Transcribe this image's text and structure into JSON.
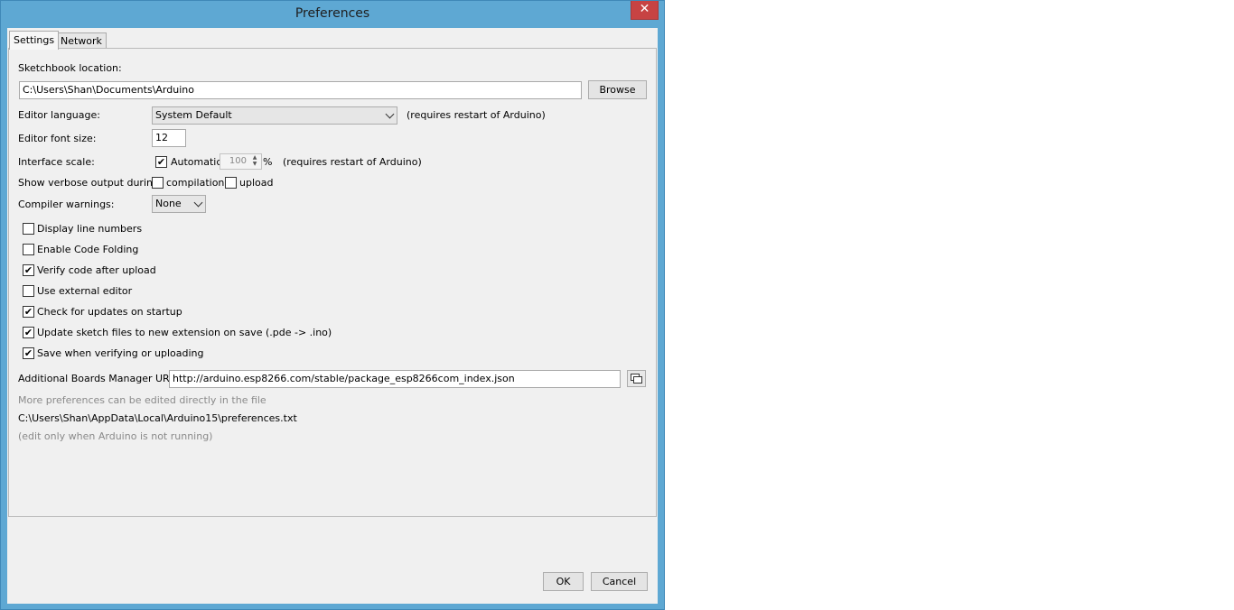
{
  "window": {
    "title": "Preferences",
    "close_glyph": "✕"
  },
  "tabs": [
    {
      "label": "Settings"
    },
    {
      "label": "Network"
    }
  ],
  "settings": {
    "sketchbook_label": "Sketchbook location:",
    "sketchbook_value": "C:\\Users\\Shan\\Documents\\Arduino",
    "browse_label": "Browse",
    "editor_language_label": "Editor language:",
    "editor_language_value": "System Default",
    "restart_note": "(requires restart of Arduino)",
    "font_size_label": "Editor font size:",
    "font_size_value": "12",
    "scale_label": "Interface scale:",
    "scale_automatic_label": "Automatic",
    "scale_automatic_checked": true,
    "scale_value": "100",
    "percent_sign": "%",
    "scale_restart_note": "(requires restart of Arduino)",
    "verbose_label": "Show verbose output during:",
    "verbose_compilation_label": "compilation",
    "verbose_compilation_checked": false,
    "verbose_upload_label": "upload",
    "verbose_upload_checked": false,
    "warnings_label": "Compiler warnings:",
    "warnings_value": "None",
    "checkboxes": [
      {
        "label": "Display line numbers",
        "checked": false
      },
      {
        "label": "Enable Code Folding",
        "checked": false
      },
      {
        "label": "Verify code after upload",
        "checked": true
      },
      {
        "label": "Use external editor",
        "checked": false
      },
      {
        "label": "Check for updates on startup",
        "checked": true
      },
      {
        "label": "Update sketch files to new extension on save (.pde -> .ino)",
        "checked": true
      },
      {
        "label": "Save when verifying or uploading",
        "checked": true
      }
    ],
    "boards_urls_label": "Additional Boards Manager URLs:",
    "boards_urls_value": "http://arduino.esp8266.com/stable/package_esp8266com_index.json",
    "more_prefs_note": "More preferences can be edited directly in the file",
    "prefs_path": "C:\\Users\\Shan\\AppData\\Local\\Arduino15\\preferences.txt",
    "edit_note": "(edit only when Arduino is not running)"
  },
  "footer": {
    "ok_label": "OK",
    "cancel_label": "Cancel"
  },
  "icons": {
    "checkbox_tick": "✔",
    "spin_up": "▲",
    "spin_down": "▼"
  },
  "colors": {
    "titlebar": "#5ea8d3",
    "close": "#c74343",
    "client": "#f0f0f0"
  }
}
